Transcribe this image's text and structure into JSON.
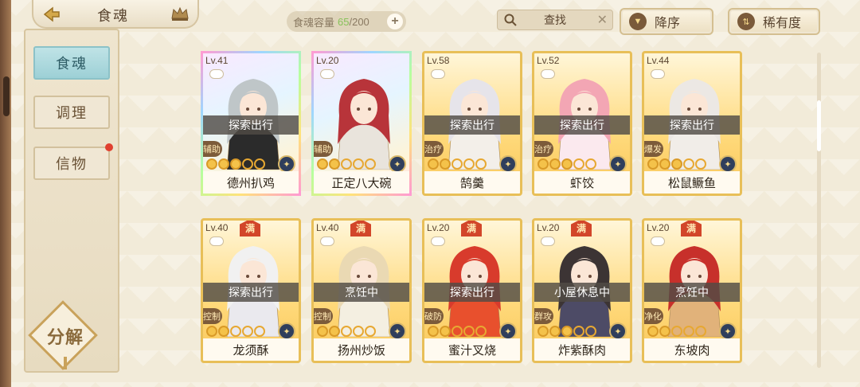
{
  "header": {
    "title": "食魂",
    "capacity_label": "食魂容量",
    "capacity_current": "65",
    "capacity_max": "/200",
    "capacity_add": "+",
    "search_label": "查找",
    "search_clear": "✕",
    "sort_desc_label": "降序",
    "sort_rarity_label": "稀有度"
  },
  "sidebar": {
    "items": [
      {
        "label": "食魂",
        "active": true
      },
      {
        "label": "调理",
        "active": false
      },
      {
        "label": "信物",
        "active": false,
        "badge": true
      }
    ],
    "decompose_label": "分解"
  },
  "cards": [
    {
      "level": "Lv.41",
      "status": "探索出行",
      "role": "辅助",
      "name": "德州扒鸡",
      "stars": 3,
      "full": false,
      "rainbow": true,
      "hair": "#bfc6c8",
      "outfit": "#2b2b2b"
    },
    {
      "level": "Lv.20",
      "status": "",
      "role": "辅助",
      "name": "正定八大碗",
      "stars": 2,
      "full": false,
      "rainbow": true,
      "hair": "#b8343a",
      "outfit": "#e9e4dc"
    },
    {
      "level": "Lv.58",
      "status": "探索出行",
      "role": "治疗",
      "name": "鹄羹",
      "stars": 2,
      "full": false,
      "rainbow": false,
      "hair": "#e6e4ea",
      "outfit": "#f3efe9"
    },
    {
      "level": "Lv.52",
      "status": "探索出行",
      "role": "治疗",
      "name": "虾饺",
      "stars": 3,
      "full": false,
      "rainbow": false,
      "hair": "#f3a6b4",
      "outfit": "#fbe9ee"
    },
    {
      "level": "Lv.44",
      "status": "探索出行",
      "role": "爆发",
      "name": "松鼠鳜鱼",
      "stars": 3,
      "full": false,
      "rainbow": false,
      "hair": "#ece8e4",
      "outfit": "#f1ede8"
    },
    {
      "level": "Lv.40",
      "status": "探索出行",
      "role": "控制",
      "name": "龙须酥",
      "stars": 2,
      "full": true,
      "rainbow": false,
      "hair": "#f1f1f1",
      "outfit": "#eae9ee"
    },
    {
      "level": "Lv.40",
      "status": "烹饪中",
      "role": "控制",
      "name": "扬州炒饭",
      "stars": 2,
      "full": true,
      "rainbow": false,
      "hair": "#ead9b3",
      "outfit": "#f4efe1"
    },
    {
      "level": "Lv.20",
      "status": "探索出行",
      "role": "破防",
      "name": "蜜汁叉烧",
      "stars": 2,
      "full": true,
      "rainbow": false,
      "hair": "#d83b2c",
      "outfit": "#e8502d"
    },
    {
      "level": "Lv.20",
      "status": "小屋休息中",
      "role": "群攻",
      "name": "炸紫酥肉",
      "stars": 3,
      "full": true,
      "rainbow": false,
      "hair": "#3c3434",
      "outfit": "#4d4b66"
    },
    {
      "level": "Lv.20",
      "status": "烹饪中",
      "role": "净化",
      "name": "东坡肉",
      "stars": 2,
      "full": true,
      "rainbow": false,
      "hair": "#c7302b",
      "outfit": "#e1b27a"
    }
  ],
  "full_badge": "满",
  "colors": {
    "accent": "#e8bf58",
    "active_tab": "#9dd0d6",
    "badge": "#e0402f",
    "capacity_current": "#88c25a"
  }
}
